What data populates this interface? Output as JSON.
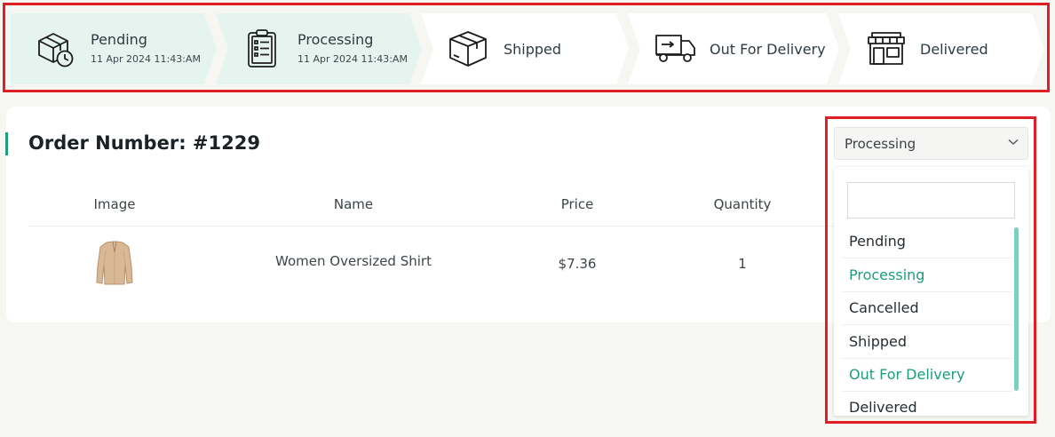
{
  "tracker": {
    "steps": [
      {
        "label": "Pending",
        "date": "11 Apr 2024 11:43:AM",
        "icon": "package-clock-icon",
        "active": true
      },
      {
        "label": "Processing",
        "date": "11 Apr 2024 11:43:AM",
        "icon": "clipboard-checklist-icon",
        "active": true
      },
      {
        "label": "Shipped",
        "date": "",
        "icon": "box-icon",
        "active": false
      },
      {
        "label": "Out For Delivery",
        "date": "",
        "icon": "delivery-truck-icon",
        "active": false
      },
      {
        "label": "Delivered",
        "date": "",
        "icon": "storefront-icon",
        "active": false
      }
    ],
    "colors": {
      "active_bg": "#e6f4ef",
      "inactive_bg": "#ffffff"
    }
  },
  "order": {
    "title": "Order Number: #1229",
    "columns": {
      "image": "Image",
      "name": "Name",
      "price": "Price",
      "quantity": "Quantity"
    },
    "items": [
      {
        "image_icon": "shirt-icon",
        "name": "Women Oversized Shirt",
        "price": "$7.36",
        "quantity": "1"
      }
    ]
  },
  "status_select": {
    "selected": "Processing",
    "search_value": "",
    "options": [
      {
        "label": "Pending",
        "highlighted": false
      },
      {
        "label": "Processing",
        "highlighted": true
      },
      {
        "label": "Cancelled",
        "highlighted": false
      },
      {
        "label": "Shipped",
        "highlighted": false
      },
      {
        "label": "Out For Delivery",
        "highlighted": true
      },
      {
        "label": "Delivered",
        "highlighted": false
      }
    ]
  },
  "colors": {
    "accent": "#1e9c7c",
    "highlight_frame": "#e01f25",
    "page_bg": "#f6f7f3"
  }
}
